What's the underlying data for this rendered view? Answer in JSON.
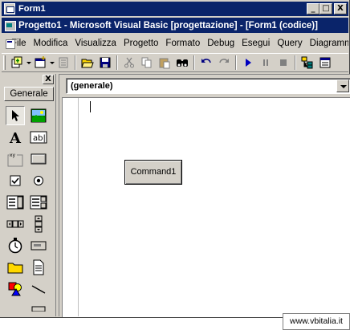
{
  "form_window": {
    "title": "Form1",
    "icon": "form-icon",
    "buttons": {
      "minimize": "_",
      "maximize": "□",
      "close": "X"
    }
  },
  "ide_window": {
    "title": "Progetto1 - Microsoft Visual Basic [progettazione] - [Form1 (codice)]",
    "icon": "vb-icon"
  },
  "menubar": {
    "items": [
      "File",
      "Modifica",
      "Visualizza",
      "Progetto",
      "Formato",
      "Debug",
      "Esegui",
      "Query",
      "Diagramma"
    ]
  },
  "toolbar": {
    "buttons": [
      "add-project-icon",
      "add-form-icon",
      "menu-editor-icon",
      "open-icon",
      "save-icon",
      "cut-icon",
      "copy-icon",
      "paste-icon",
      "find-icon",
      "undo-icon",
      "redo-icon",
      "start-icon",
      "pause-icon",
      "stop-icon",
      "project-explorer-icon",
      "properties-icon"
    ]
  },
  "toolbox": {
    "close_label": "X",
    "tab_label": "Generale",
    "tools": [
      "pointer-icon",
      "picturebox-icon",
      "label-icon",
      "textbox-icon",
      "frame-icon",
      "commandbutton-icon",
      "checkbox-icon",
      "optionbutton-icon",
      "combobox-icon",
      "listbox-icon",
      "hscrollbar-icon",
      "vscrollbar-icon",
      "timer-icon",
      "drivelistbox-icon",
      "dirlistbox-icon",
      "filelistbox-icon",
      "shape-icon",
      "line-icon"
    ]
  },
  "code_window": {
    "object_combo": "(generale)"
  },
  "form_control": {
    "caption": "Command1"
  },
  "watermark": {
    "text": "www.vbitalia.it"
  },
  "colors": {
    "titlebar": "#0a246a",
    "face": "#d4d0c8"
  }
}
